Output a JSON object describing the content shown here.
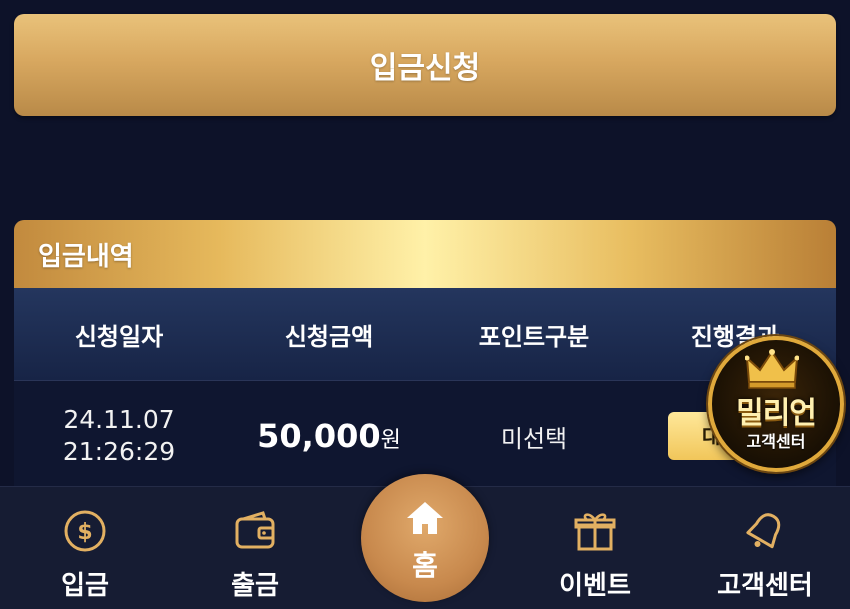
{
  "deposit_request": {
    "label": "입금신청"
  },
  "history": {
    "title": "입금내역",
    "columns": [
      "신청일자",
      "신청금액",
      "포인트구분",
      "진행결과"
    ],
    "rows": [
      {
        "date": "24.11.07",
        "time": "21:26:29",
        "amount": "50,000",
        "unit": "원",
        "point": "미선택",
        "status": "대기"
      }
    ]
  },
  "cs_badge": {
    "brand": "밀리언",
    "subtitle": "고객센터"
  },
  "bottom_nav": {
    "deposit": "입금",
    "withdraw": "출금",
    "home": "홈",
    "event": "이벤트",
    "support": "고객센터"
  },
  "colors": {
    "gold": "#d8a860",
    "background": "#0d1229",
    "nav_bg": "#161c33"
  }
}
